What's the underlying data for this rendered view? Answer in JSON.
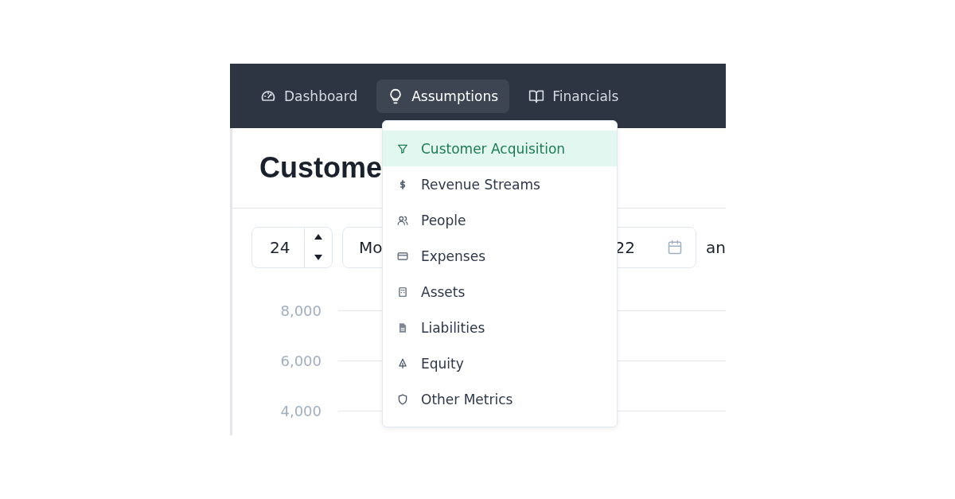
{
  "nav": {
    "items": [
      {
        "label": "Dashboard",
        "selected": false
      },
      {
        "label": "Assumptions",
        "selected": true
      },
      {
        "label": "Financials",
        "selected": false
      }
    ]
  },
  "page": {
    "heading": "Custome"
  },
  "controls": {
    "count": "24",
    "select_value": "Mo",
    "date_value": "22",
    "trailing_text": "an"
  },
  "chart": {
    "y_ticks": [
      "8,000",
      "6,000",
      "4,000"
    ]
  },
  "dropdown": {
    "items": [
      {
        "label": "Customer Acquisition",
        "selected": true
      },
      {
        "label": "Revenue Streams",
        "selected": false
      },
      {
        "label": "People",
        "selected": false
      },
      {
        "label": "Expenses",
        "selected": false
      },
      {
        "label": "Assets",
        "selected": false
      },
      {
        "label": "Liabilities",
        "selected": false
      },
      {
        "label": "Equity",
        "selected": false
      },
      {
        "label": "Other Metrics",
        "selected": false
      }
    ]
  }
}
